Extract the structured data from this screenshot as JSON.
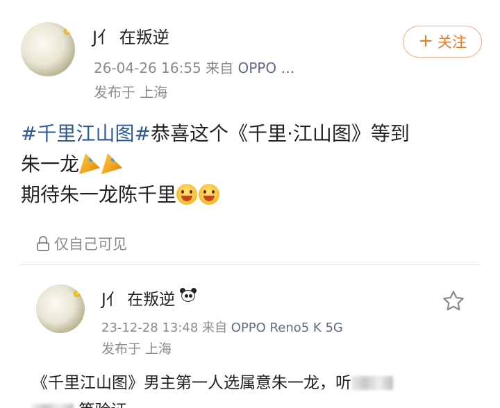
{
  "post1": {
    "user_name": "J亻 在叛逆",
    "date": "26-04-26 16:55",
    "source_prefix": "来自",
    "device": "OPPO …",
    "location": "发布于 上海",
    "follow_label": "关注",
    "topic": "#千里江山图#",
    "text_line1": "恭喜这个《千里·江山图》等到",
    "text_line2": "朱一龙",
    "text_line3": "期待朱一龙陈千里",
    "privacy_label": "仅自己可见"
  },
  "post2": {
    "user_name": "J亻 在叛逆",
    "date": "23-12-28 13:48",
    "source_prefix": "来自",
    "device": "OPPO Reno5 K 5G",
    "location": "发布于 上海",
    "text_part1": "《千里江山图》男主第一人选属意朱一龙，听",
    "text_part2": "等验证"
  },
  "colors": {
    "topic_link": "#2e5a94",
    "follow_accent": "#f07a2a",
    "meta_gray": "#8a8a8a"
  }
}
